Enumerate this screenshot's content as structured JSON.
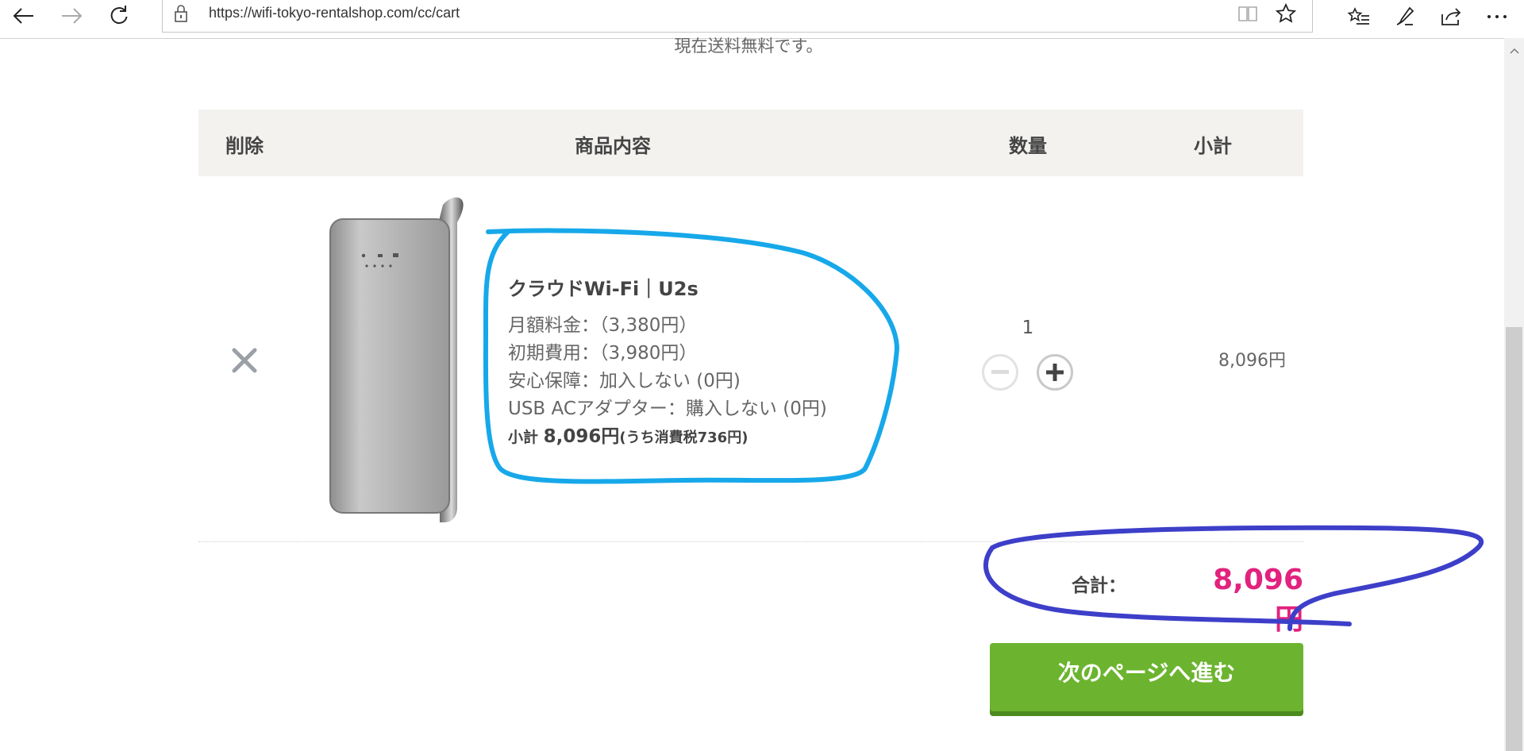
{
  "browser": {
    "url": "https://wifi-tokyo-rentalshop.com/cc/cart",
    "icons": [
      "back-icon",
      "forward-icon",
      "refresh-icon",
      "lock-icon",
      "reading-view-icon",
      "favorite-star-icon",
      "favorites-hub-icon",
      "pen-icon",
      "share-icon",
      "more-icon"
    ]
  },
  "page": {
    "shipping_notice": "現在送料無料です。",
    "table_headers": {
      "delete": "削除",
      "product": "商品内容",
      "quantity": "数量",
      "subtotal": "小計"
    },
    "item": {
      "name": "クラウドWi-Fi｜U2s",
      "lines": [
        "月額料金：（3,380円）",
        "初期費用：（3,980円）",
        "安心保障：加入しない (0円)",
        "USB ACアダプター：購入しない (0円)"
      ],
      "subtotal_label": "小計 ",
      "subtotal_amount": "8,096円",
      "tax_note": "(うち消費税736円)",
      "quantity": "1",
      "row_subtotal": "8,096円"
    },
    "total_label": "合計：",
    "total_value": "8,096円",
    "next_button": "次のページへ進む"
  },
  "colors": {
    "header_bg": "#f3f2ef",
    "total_pink": "#e2227e",
    "button_green": "#6cb42f",
    "annotation_cyan": "#17a8ea",
    "annotation_blue": "#3d3fc9"
  }
}
